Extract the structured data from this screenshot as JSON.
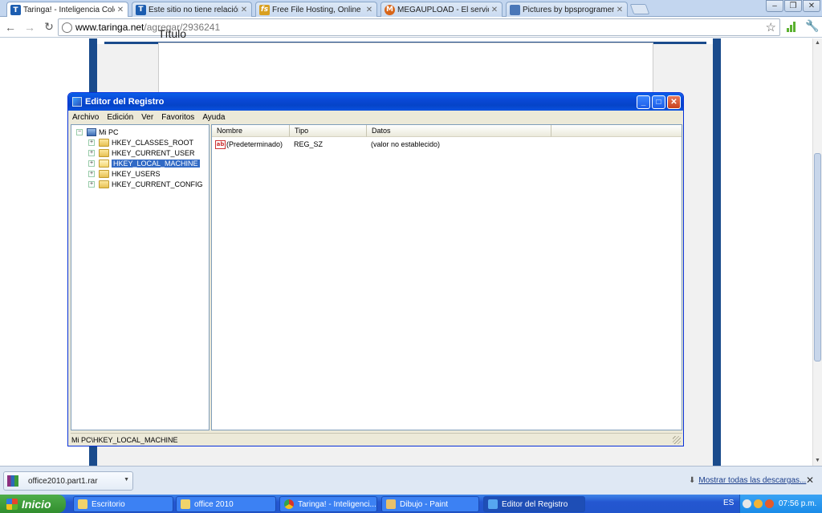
{
  "browser": {
    "tabs": [
      {
        "label": "Taringa! - Inteligencia Colectiva",
        "favicon": "taringa-icon",
        "favicon_text": "T",
        "favicon_color": "#1c5db0",
        "active": true
      },
      {
        "label": "Este sitio no tiene relación con",
        "favicon": "taringa-icon",
        "favicon_text": "T",
        "favicon_color": "#1c5db0",
        "active": false
      },
      {
        "label": "Free File Hosting, Online Storage",
        "favicon": "filesonic-icon",
        "favicon_text": "fs",
        "favicon_color": "#d9a021",
        "active": false
      },
      {
        "label": "MEGAUPLOAD - El servicio líder",
        "favicon": "megaupload-icon",
        "favicon_text": "M",
        "favicon_color": "#d8661a",
        "active": false
      },
      {
        "label": "Pictures by bpsprogramer - Ph",
        "favicon": "photobucket-icon",
        "favicon_text": "",
        "favicon_color": "#4a77b8",
        "active": false
      }
    ],
    "url_host": "www.taringa.net",
    "url_path": "/agregar/2936241"
  },
  "page": {
    "title_label": "Título"
  },
  "regedit": {
    "title": "Editor del Registro",
    "menu": [
      "Archivo",
      "Edición",
      "Ver",
      "Favoritos",
      "Ayuda"
    ],
    "tree_root": "Mi PC",
    "tree_items": [
      "HKEY_CLASSES_ROOT",
      "HKEY_CURRENT_USER",
      "HKEY_LOCAL_MACHINE",
      "HKEY_USERS",
      "HKEY_CURRENT_CONFIG"
    ],
    "selected_item": "HKEY_LOCAL_MACHINE",
    "columns": [
      "Nombre",
      "Tipo",
      "Datos"
    ],
    "row": {
      "name": "(Predeterminado)",
      "type": "REG_SZ",
      "data": "(valor no establecido)"
    },
    "status": "Mi PC\\HKEY_LOCAL_MACHINE"
  },
  "downloads": {
    "file": "office2010.part1.rar",
    "show_all": "Mostrar todas las descargas..."
  },
  "taskbar": {
    "start": "Inicio",
    "buttons": [
      {
        "label": "Escritorio",
        "icon": "folder-icon",
        "color": "#f1d36b"
      },
      {
        "label": "office 2010",
        "icon": "folder-icon",
        "color": "#f1d36b"
      },
      {
        "label": "Taringa! - Inteligenci...",
        "icon": "chrome-icon",
        "color": "#e4ab2a"
      },
      {
        "label": "Dibujo - Paint",
        "icon": "paint-icon",
        "color": "#e8c06a"
      },
      {
        "label": "Editor del Registro",
        "icon": "regedit-icon",
        "color": "#56a6f0"
      }
    ],
    "lang": "ES",
    "clock": "07:56 p.m."
  }
}
